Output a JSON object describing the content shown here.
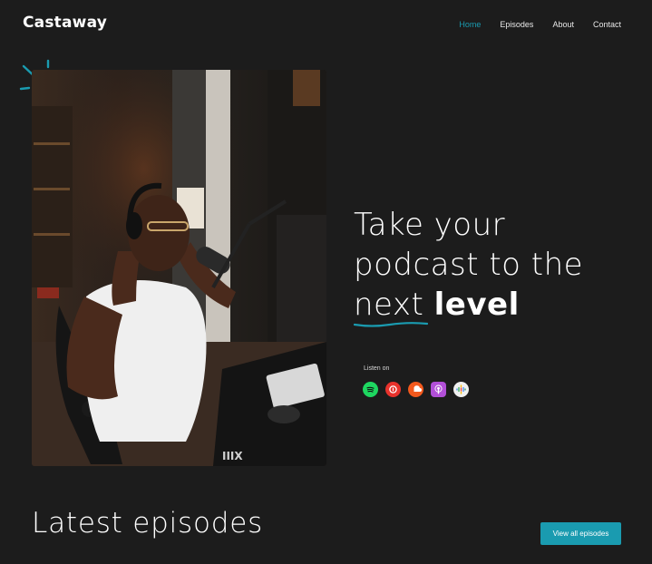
{
  "brand": {
    "name": "Castaway"
  },
  "nav": {
    "items": [
      {
        "label": "Home",
        "active": true
      },
      {
        "label": "Episodes",
        "active": false
      },
      {
        "label": "About",
        "active": false
      },
      {
        "label": "Contact",
        "active": false
      }
    ]
  },
  "hero": {
    "headline_line1": "Take your",
    "headline_line2": "podcast to the",
    "headline_word_next": "next",
    "headline_word_level": "level",
    "photo_alt": "Man wearing headphones at a podcast microphone",
    "listen_label": "Listen on",
    "platforms": [
      {
        "icon": "spotify-icon",
        "color": "#1ed760"
      },
      {
        "icon": "castbox-icon",
        "color": "#e8322c"
      },
      {
        "icon": "soundcloud-icon",
        "color": "#f2591d"
      },
      {
        "icon": "apple-podcasts-icon",
        "color": "#b24fd8"
      },
      {
        "icon": "google-podcasts-icon",
        "color": "#f0f0f0"
      }
    ]
  },
  "latest": {
    "title": "Latest episodes",
    "button_label": "View all episodes"
  },
  "colors": {
    "accent": "#1a9bb0",
    "background": "#1c1c1c"
  }
}
